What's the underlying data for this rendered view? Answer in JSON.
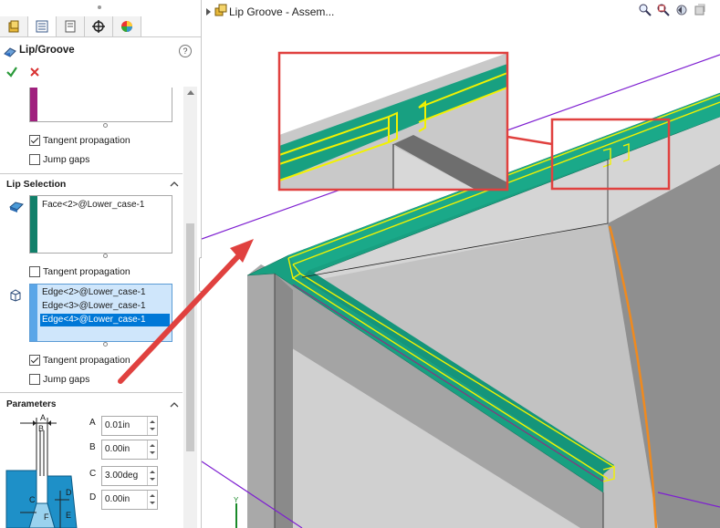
{
  "panel": {
    "tabs": [
      {
        "icon": "feature-manager-icon"
      },
      {
        "icon": "property-manager-icon"
      },
      {
        "icon": "configuration-manager-icon"
      },
      {
        "icon": "dimxpert-icon"
      },
      {
        "icon": "display-manager-icon"
      }
    ],
    "title": "Lip/Groove",
    "help_label": "?",
    "ok_icon": "check-icon",
    "cancel_icon": "close-icon",
    "groove": {
      "tangent_label": "Tangent propagation",
      "tangent_checked": true,
      "jump_label": "Jump gaps",
      "jump_checked": false
    },
    "lip_selection": {
      "header": "Lip Selection",
      "faces": [
        "Face<2>@Lower_case-1"
      ],
      "face_tangent_label": "Tangent propagation",
      "face_tangent_checked": false,
      "edges": [
        "Edge<2>@Lower_case-1",
        "Edge<3>@Lower_case-1",
        "Edge<4>@Lower_case-1"
      ],
      "selected_edge_index": 2,
      "edge_tangent_label": "Tangent propagation",
      "edge_tangent_checked": true,
      "edge_jump_label": "Jump gaps",
      "edge_jump_checked": false
    },
    "parameters": {
      "header": "Parameters",
      "diagram_labels": {
        "A": "A",
        "B": "B",
        "C": "C",
        "D": "D",
        "E": "E",
        "F": "F"
      },
      "fields": [
        {
          "label": "A",
          "value": "0.01in"
        },
        {
          "label": "B",
          "value": "0.00in"
        },
        {
          "label": "C",
          "value": "3.00deg"
        },
        {
          "label": "D",
          "value": "0.00in"
        }
      ]
    },
    "colors": {
      "magenta": "#a0207e",
      "teal": "#11806a",
      "selection": "#0078d7"
    }
  },
  "viewport": {
    "title": "Lip Groove - Assem...",
    "toolbar_icons": [
      "zoom-to-fit-icon",
      "zoom-to-area-icon",
      "previous-view-icon",
      "section-view-icon"
    ],
    "colors": {
      "teal": "#18a081",
      "highlight": "#f2f200",
      "callout": "#e0413f",
      "sketch": "#7e1fd1",
      "edge": "#f08a1e"
    }
  }
}
